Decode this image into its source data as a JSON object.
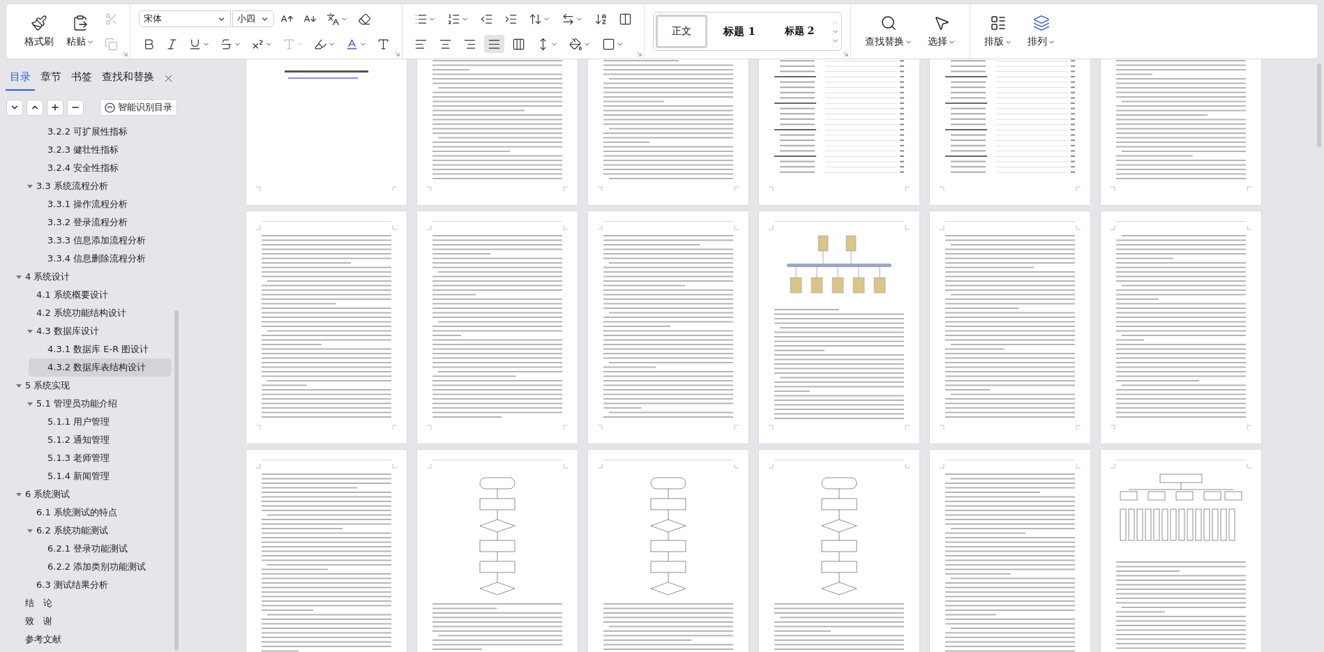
{
  "ribbon": {
    "clipboard": {
      "format_painter": "格式刷",
      "paste": "粘贴",
      "small": [
        {
          "kind": "cut",
          "disabled": true
        },
        {
          "kind": "copy",
          "disabled": true
        }
      ]
    },
    "font": {
      "name": "宋体",
      "size": "小四",
      "row1": [
        {
          "kind": "grow",
          "dropdown": false,
          "disabled": false
        },
        {
          "kind": "shrink",
          "dropdown": false,
          "disabled": false
        },
        {
          "kind": "phonetic",
          "dropdown": true,
          "disabled": false
        },
        {
          "kind": "eraser",
          "dropdown": false,
          "disabled": false
        }
      ],
      "row2": [
        {
          "kind": "bold",
          "dropdown": false,
          "disabled": false
        },
        {
          "kind": "italic",
          "dropdown": false,
          "disabled": false
        },
        {
          "kind": "underline",
          "dropdown": true,
          "disabled": false
        },
        {
          "kind": "strike",
          "dropdown": true,
          "disabled": false
        },
        {
          "kind": "superscript",
          "dropdown": true,
          "disabled": false
        },
        {
          "kind": "effect",
          "dropdown": true,
          "disabled": true
        },
        {
          "kind": "highlight",
          "dropdown": true,
          "disabled": false
        },
        {
          "kind": "color",
          "dropdown": true,
          "disabled": false
        },
        {
          "kind": "shading",
          "dropdown": false,
          "disabled": false
        }
      ]
    },
    "paragraph": {
      "row1": [
        {
          "kind": "bullets",
          "dropdown": true
        },
        {
          "kind": "numbering",
          "dropdown": true
        },
        {
          "kind": "outdent",
          "dropdown": false
        },
        {
          "kind": "indent",
          "dropdown": false
        },
        {
          "kind": "direction",
          "dropdown": true
        },
        {
          "kind": "swap",
          "dropdown": true
        },
        {
          "kind": "sort",
          "dropdown": false
        },
        {
          "kind": "columns",
          "dropdown": false
        }
      ],
      "align": [
        {
          "kind": "left",
          "selected": false
        },
        {
          "kind": "center",
          "selected": false
        },
        {
          "kind": "right",
          "selected": false
        },
        {
          "kind": "justify",
          "selected": true
        },
        {
          "kind": "distributed",
          "selected": false
        }
      ],
      "row2": [
        {
          "kind": "spacing",
          "dropdown": true
        },
        {
          "kind": "fill",
          "dropdown": true
        },
        {
          "kind": "border",
          "dropdown": true
        }
      ]
    },
    "styles": [
      {
        "label": "正文",
        "kind": "body",
        "selected": true
      },
      {
        "label": "标题 1",
        "kind": "heading",
        "selected": false
      },
      {
        "label": "标题 2",
        "kind": "subheading",
        "selected": false
      }
    ],
    "tools": [
      {
        "label": "查找替换",
        "kind": "search"
      },
      {
        "label": "选择",
        "kind": "select"
      },
      {
        "label": "排版",
        "kind": "layout"
      },
      {
        "label": "排列",
        "kind": "arrange"
      }
    ]
  },
  "sidebar": {
    "tabs": [
      {
        "label": "目录",
        "selected": true
      },
      {
        "label": "章节",
        "selected": false
      },
      {
        "label": "书签",
        "selected": false
      },
      {
        "label": "查找和替换",
        "selected": false
      }
    ],
    "controls": [
      {
        "kind": "down"
      },
      {
        "kind": "up"
      },
      {
        "kind": "plus"
      },
      {
        "kind": "minus"
      }
    ],
    "smart_button": "智能识别目录",
    "toc": [
      {
        "children": [
          {
            "children": [
              {
                "label": "3.2.2 可扩展性指标",
                "selected": false
              },
              {
                "label": "3.2.3 健壮性指标",
                "selected": false
              },
              {
                "label": "3.2.4 安全性指标",
                "selected": false
              }
            ]
          },
          {
            "label": "3.3 系统流程分析",
            "selected": false,
            "expanded": true,
            "children": [
              {
                "label": "3.3.1 操作流程分析",
                "selected": false
              },
              {
                "label": "3.3.2 登录流程分析",
                "selected": false
              },
              {
                "label": "3.3.3 信息添加流程分析",
                "selected": false
              },
              {
                "label": "3.3.4 信息删除流程分析",
                "selected": false
              }
            ]
          }
        ]
      },
      {
        "label": "4 系统设计",
        "selected": false,
        "expanded": true,
        "children": [
          {
            "label": "4.1 系统概要设计",
            "selected": false
          },
          {
            "label": "4.2 系统功能结构设计",
            "selected": false
          },
          {
            "label": "4.3 数据库设计",
            "selected": false,
            "expanded": true,
            "children": [
              {
                "label": "4.3.1 数据库 E-R 图设计",
                "selected": false
              },
              {
                "label": "4.3.2 数据库表结构设计",
                "selected": true
              }
            ]
          }
        ]
      },
      {
        "label": "5 系统实现",
        "selected": false,
        "expanded": true,
        "children": [
          {
            "label": "5.1 管理员功能介绍",
            "selected": false,
            "expanded": true,
            "children": [
              {
                "label": "5.1.1 用户管理",
                "selected": false
              },
              {
                "label": "5.1.2 通知管理",
                "selected": false
              },
              {
                "label": "5.1.3 老师管理",
                "selected": false
              },
              {
                "label": "5.1.4 新闻管理",
                "selected": false
              }
            ]
          }
        ]
      },
      {
        "label": "6 系统测试",
        "selected": false,
        "expanded": true,
        "children": [
          {
            "label": "6.1 系统测试的特点",
            "selected": false
          },
          {
            "label": "6.2 系统功能测试",
            "selected": false,
            "expanded": true,
            "children": [
              {
                "label": "6.2.1 登录功能测试",
                "selected": false
              },
              {
                "label": "6.2.2 添加类别功能测试",
                "selected": false
              }
            ]
          },
          {
            "label": "6.3 测试结果分析",
            "selected": false
          }
        ]
      },
      {
        "label": "结　论",
        "selected": false
      },
      {
        "label": "致　谢",
        "selected": false
      },
      {
        "label": "参考文献",
        "selected": false
      }
    ]
  },
  "pages": [
    {
      "kind": "cover"
    },
    {
      "kind": "text"
    },
    {
      "kind": "text"
    },
    {
      "kind": "toc"
    },
    {
      "kind": "toc"
    },
    {
      "kind": "text"
    },
    {
      "kind": "text"
    },
    {
      "kind": "text"
    },
    {
      "kind": "text"
    },
    {
      "kind": "network"
    },
    {
      "kind": "text"
    },
    {
      "kind": "text"
    },
    {
      "kind": "text"
    },
    {
      "kind": "flowchart"
    },
    {
      "kind": "flowchart"
    },
    {
      "kind": "flowchart"
    },
    {
      "kind": "text"
    },
    {
      "kind": "tree"
    }
  ]
}
